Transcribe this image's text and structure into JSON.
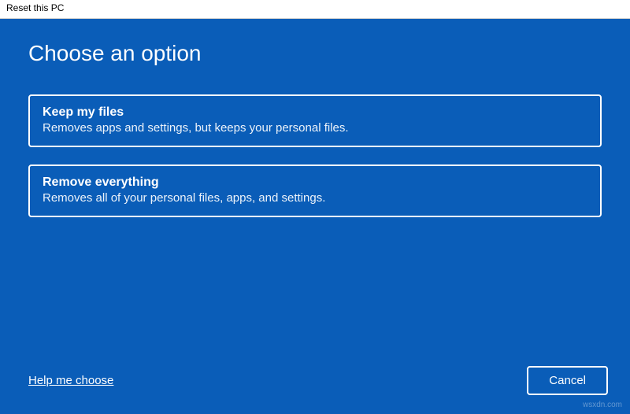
{
  "window": {
    "title": "Reset this PC"
  },
  "heading": "Choose an option",
  "options": [
    {
      "title": "Keep my files",
      "description": "Removes apps and settings, but keeps your personal files."
    },
    {
      "title": "Remove everything",
      "description": "Removes all of your personal files, apps, and settings."
    }
  ],
  "footer": {
    "help_label": "Help me choose",
    "cancel_label": "Cancel"
  },
  "watermark": "wsxdn.com"
}
